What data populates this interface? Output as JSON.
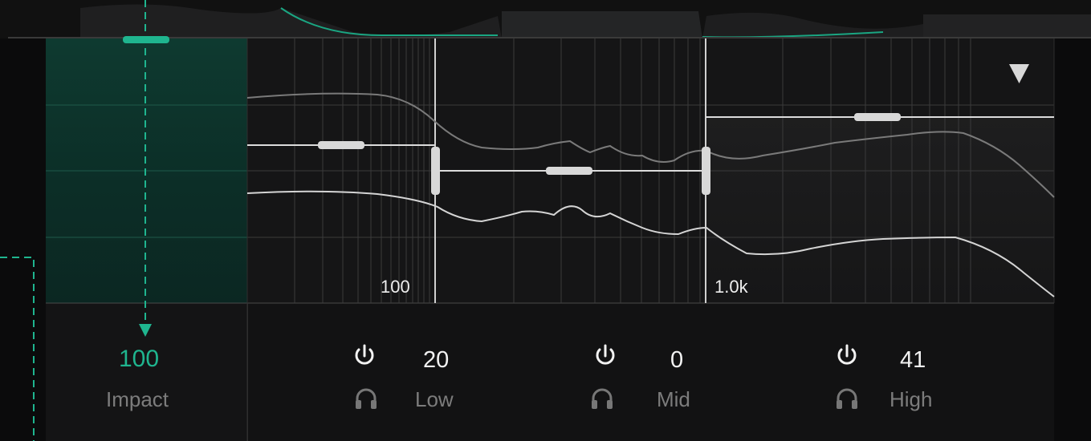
{
  "colors": {
    "accent": "#1fb58f",
    "text": "#f2f2f2",
    "label": "#7c7c7c",
    "handle": "#d8d8d8"
  },
  "menu": {
    "icon": "triangle-down-icon"
  },
  "axis": {
    "freq_labels": [
      "100",
      "1.0k"
    ]
  },
  "impact": {
    "value": "100",
    "label": "Impact"
  },
  "bands": [
    {
      "name": "Low",
      "value": "20",
      "power_icon": "power-icon",
      "solo_icon": "headphones-icon"
    },
    {
      "name": "Mid",
      "value": "0",
      "power_icon": "power-icon",
      "solo_icon": "headphones-icon"
    },
    {
      "name": "High",
      "value": "41",
      "power_icon": "power-icon",
      "solo_icon": "headphones-icon"
    }
  ]
}
